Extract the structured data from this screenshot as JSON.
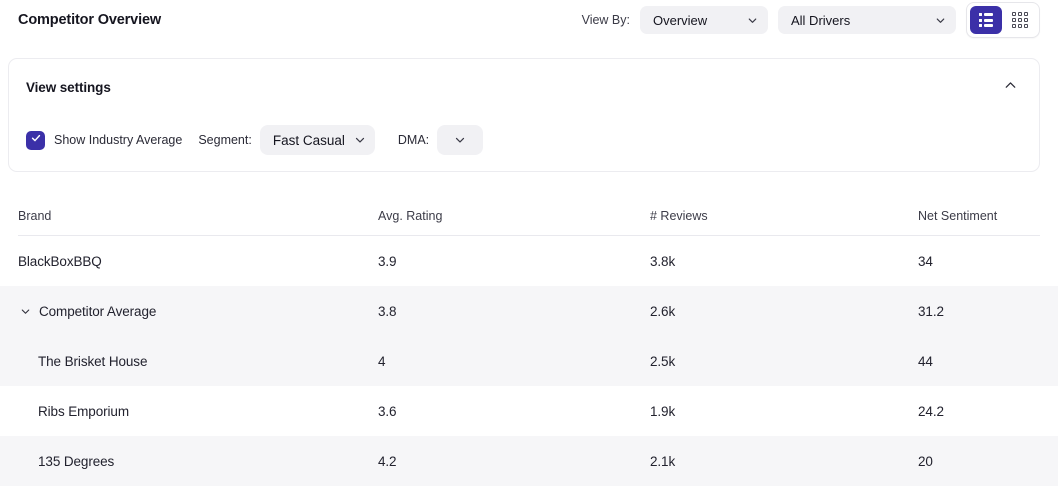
{
  "header": {
    "title": "Competitor Overview",
    "view_by_label": "View By:",
    "view_by_value": "Overview",
    "drivers_value": "All Drivers",
    "list_view_icon": "list-view-icon",
    "grid_view_icon": "grid-view-icon"
  },
  "settings": {
    "title": "View settings",
    "collapse_icon": "chevron-up-icon",
    "show_industry_average_label": "Show Industry Average",
    "show_industry_average_checked": true,
    "check_icon": "check-icon",
    "segment_label": "Segment:",
    "segment_value": "Fast Casual",
    "dma_label": "DMA:",
    "dma_value": ""
  },
  "table": {
    "columns": [
      "Brand",
      "Avg. Rating",
      "# Reviews",
      "Net Sentiment"
    ],
    "rows": [
      {
        "brand": "BlackBoxBBQ",
        "rating": "3.9",
        "reviews": "3.8k",
        "sentiment": "34",
        "shaded": false,
        "expandable": false,
        "indented": false
      },
      {
        "brand": "Competitor Average",
        "rating": "3.8",
        "reviews": "2.6k",
        "sentiment": "31.2",
        "shaded": true,
        "expandable": true,
        "indented": false
      },
      {
        "brand": "The Brisket House",
        "rating": "4",
        "reviews": "2.5k",
        "sentiment": "44",
        "shaded": true,
        "expandable": false,
        "indented": true
      },
      {
        "brand": "Ribs Emporium",
        "rating": "3.6",
        "reviews": "1.9k",
        "sentiment": "24.2",
        "shaded": false,
        "expandable": false,
        "indented": true
      },
      {
        "brand": "135 Degrees",
        "rating": "4.2",
        "reviews": "2.1k",
        "sentiment": "20",
        "shaded": true,
        "expandable": false,
        "indented": true
      }
    ]
  },
  "colors": {
    "accent": "#3b30a8",
    "pill_bg": "#f1f1f4",
    "row_shade": "#f6f6f8",
    "border": "#ececf0"
  }
}
